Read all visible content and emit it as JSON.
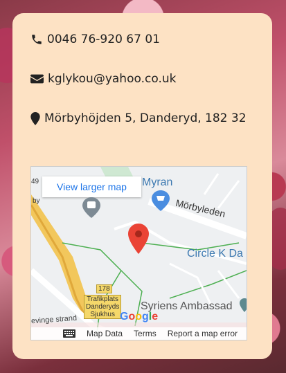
{
  "contact": {
    "phone": "0046 76-920 67 01",
    "email": "kglykou@yahoo.co.uk",
    "address": "Mörbyhöjden 5, Danderyd, 182 32"
  },
  "map": {
    "view_larger": "View larger map",
    "labels": {
      "myran": "Myran",
      "morbyleden": "Mörbyleden",
      "circle_k": "Circle K Da",
      "syriens": "Syriens Ambassad",
      "vinge_strand": "evinge strand",
      "road_num": "178",
      "sign_line1": "Trafikplats",
      "sign_line2": "Danderyds",
      "sign_line3": "Sjukhus",
      "left_top": "49",
      "left_mid": "by",
      "google": "Google"
    },
    "footer": {
      "map_data": "Map Data",
      "terms": "Terms",
      "report": "Report a map error"
    }
  },
  "colors": {
    "card": "#fde2c4",
    "link": "#1a73e8",
    "pin": "#ea4335"
  }
}
